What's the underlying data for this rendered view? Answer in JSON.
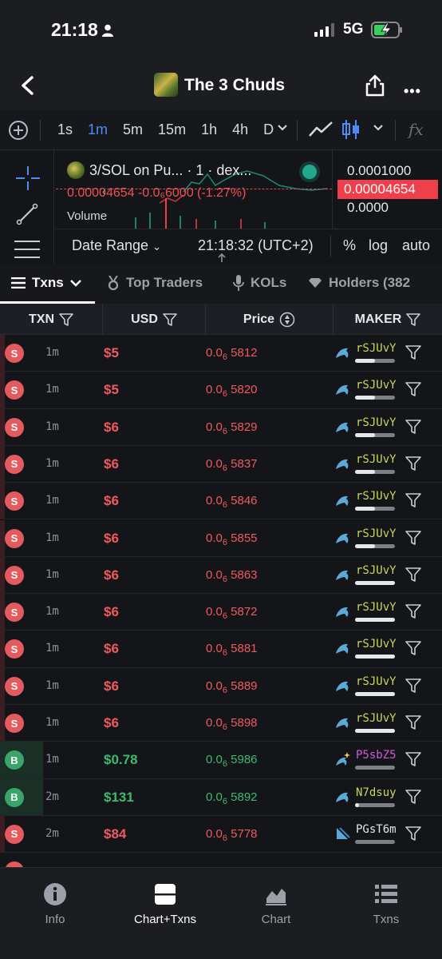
{
  "status": {
    "time": "21:18",
    "network": "5G"
  },
  "header": {
    "title": "The 3 Chuds"
  },
  "toolbar": {
    "intervals": [
      "1s",
      "1m",
      "5m",
      "15m",
      "1h",
      "4h",
      "D"
    ],
    "active_interval": "1m",
    "fx_label": "fx"
  },
  "chart": {
    "pair": "3/SOL on Pu... · 1 · dex...",
    "ohlc": "0.00004654 -0.0₆6000 (-1.27%)",
    "volume_label": "Volume",
    "axis_top": "0.0001000",
    "axis_current": "0.00004654",
    "axis_bottom": "0.0000",
    "date_range": "Date Range",
    "clock": "21:18:32 (UTC+2)",
    "pct": "%",
    "log": "log",
    "auto": "auto",
    "up_color": "#1fa88b",
    "down_color": "#ef3f4b"
  },
  "tabs": [
    {
      "label": "Txns",
      "icon": "list-icon",
      "active": true
    },
    {
      "label": "Top Traders",
      "icon": "medal-icon"
    },
    {
      "label": "KOLs",
      "icon": "microphone-icon"
    },
    {
      "label": "Holders (382",
      "icon": "heart-icon"
    }
  ],
  "columns": [
    "TXN",
    "USD",
    "Price",
    "MAKER"
  ],
  "rows": [
    {
      "type": "S",
      "age": "1m",
      "usd": "$5",
      "price_prefix": "0.0",
      "price_sub": "6",
      "price_digits": "5812",
      "maker": "rSJUvY",
      "maker_icon": "dolphin-icon",
      "bar_fill": 0.5
    },
    {
      "type": "S",
      "age": "1m",
      "usd": "$5",
      "price_prefix": "0.0",
      "price_sub": "6",
      "price_digits": "5820",
      "maker": "rSJUvY",
      "maker_icon": "dolphin-icon",
      "bar_fill": 0.5
    },
    {
      "type": "S",
      "age": "1m",
      "usd": "$6",
      "price_prefix": "0.0",
      "price_sub": "6",
      "price_digits": "5829",
      "maker": "rSJUvY",
      "maker_icon": "dolphin-icon",
      "bar_fill": 0.5
    },
    {
      "type": "S",
      "age": "1m",
      "usd": "$6",
      "price_prefix": "0.0",
      "price_sub": "6",
      "price_digits": "5837",
      "maker": "rSJUvY",
      "maker_icon": "dolphin-icon",
      "bar_fill": 0.5
    },
    {
      "type": "S",
      "age": "1m",
      "usd": "$6",
      "price_prefix": "0.0",
      "price_sub": "6",
      "price_digits": "5846",
      "maker": "rSJUvY",
      "maker_icon": "dolphin-icon",
      "bar_fill": 0.5
    },
    {
      "type": "S",
      "age": "1m",
      "usd": "$6",
      "price_prefix": "0.0",
      "price_sub": "6",
      "price_digits": "5855",
      "maker": "rSJUvY",
      "maker_icon": "dolphin-icon",
      "bar_fill": 0.5
    },
    {
      "type": "S",
      "age": "1m",
      "usd": "$6",
      "price_prefix": "0.0",
      "price_sub": "6",
      "price_digits": "5863",
      "maker": "rSJUvY",
      "maker_icon": "dolphin-icon",
      "bar_fill": 1.0
    },
    {
      "type": "S",
      "age": "1m",
      "usd": "$6",
      "price_prefix": "0.0",
      "price_sub": "6",
      "price_digits": "5872",
      "maker": "rSJUvY",
      "maker_icon": "dolphin-icon",
      "bar_fill": 1.0
    },
    {
      "type": "S",
      "age": "1m",
      "usd": "$6",
      "price_prefix": "0.0",
      "price_sub": "6",
      "price_digits": "5881",
      "maker": "rSJUvY",
      "maker_icon": "dolphin-icon",
      "bar_fill": 1.0
    },
    {
      "type": "S",
      "age": "1m",
      "usd": "$6",
      "price_prefix": "0.0",
      "price_sub": "6",
      "price_digits": "5889",
      "maker": "rSJUvY",
      "maker_icon": "dolphin-icon",
      "bar_fill": 1.0
    },
    {
      "type": "S",
      "age": "1m",
      "usd": "$6",
      "price_prefix": "0.0",
      "price_sub": "6",
      "price_digits": "5898",
      "maker": "rSJUvY",
      "maker_icon": "dolphin-icon",
      "bar_fill": 1.0
    },
    {
      "type": "B",
      "age": "1m",
      "usd": "$0.78",
      "price_prefix": "0.0",
      "price_sub": "6",
      "price_digits": "5986",
      "maker": "P5sbZ5",
      "maker_icon": "sparkle-dolphin-icon",
      "bar_fill": 0.0,
      "maker_color": "#d05ad8"
    },
    {
      "type": "B",
      "age": "2m",
      "usd": "$131",
      "price_prefix": "0.0",
      "price_sub": "6",
      "price_digits": "5892",
      "maker": "N7dsuy",
      "maker_icon": "dolphin-icon",
      "bar_fill": 0.1
    },
    {
      "type": "S",
      "age": "2m",
      "usd": "$84",
      "price_prefix": "0.0",
      "price_sub": "6",
      "price_digits": "5778",
      "maker": "PGsT6m",
      "maker_icon": "shell-icon",
      "bar_fill": 0.0,
      "maker_color": "#e6e7ea"
    }
  ],
  "colors": {
    "sell": "#ef5a5f",
    "buy": "#3dba6e",
    "sell_badge": "#e35b5f",
    "buy_badge": "#3aa46a"
  },
  "nav": [
    {
      "label": "Info",
      "icon": "info-icon"
    },
    {
      "label": "Chart+Txns",
      "icon": "chart-txns-icon",
      "active": true
    },
    {
      "label": "Chart",
      "icon": "area-chart-icon"
    },
    {
      "label": "Txns",
      "icon": "list-icon"
    }
  ]
}
